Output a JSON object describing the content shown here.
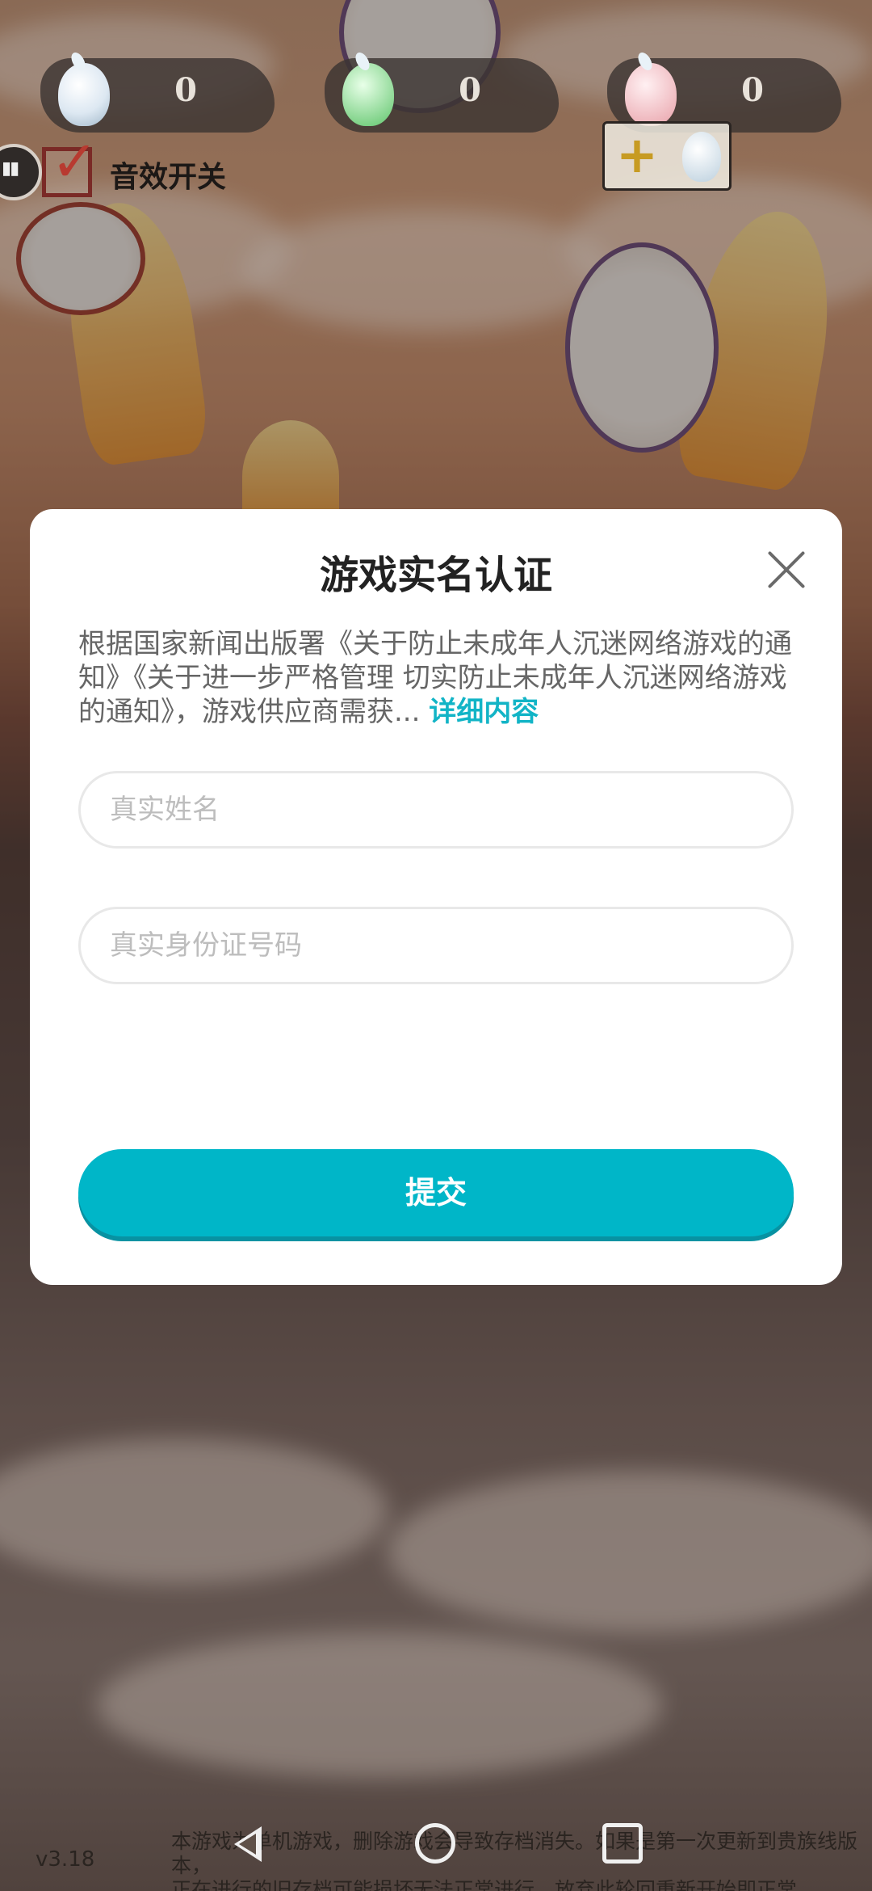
{
  "hud": {
    "counters": [
      {
        "icon": "white-ghost-icon",
        "value": "0"
      },
      {
        "icon": "green-ghost-icon",
        "value": "0"
      },
      {
        "icon": "pink-ghost-icon",
        "value": "0"
      }
    ],
    "sound_toggle_label": "音效开关",
    "sound_enabled": true
  },
  "dialog": {
    "title": "游戏实名认证",
    "notice_text": "根据国家新闻出版署《关于防止未成年人沉迷网络游戏的通知》《关于进一步严格管理 切实防止未成年人沉迷网络游戏的通知》，游戏供应商需获...",
    "details_link": "详细内容",
    "name_placeholder": "真实姓名",
    "id_placeholder": "真实身份证号码",
    "submit_label": "提交"
  },
  "footer": {
    "version": "v3.18",
    "line1": "本游戏为单机游戏，删除游戏会导致存档消失。如果是第一次更新到贵族线版本，",
    "line2": "正在进行的旧存档可能损坏无法正常进行，放弃此轮回重新开始即正常"
  },
  "colors": {
    "accent": "#00b6c8",
    "link": "#12b4c6",
    "title": "#222222",
    "body_text": "#666666"
  }
}
